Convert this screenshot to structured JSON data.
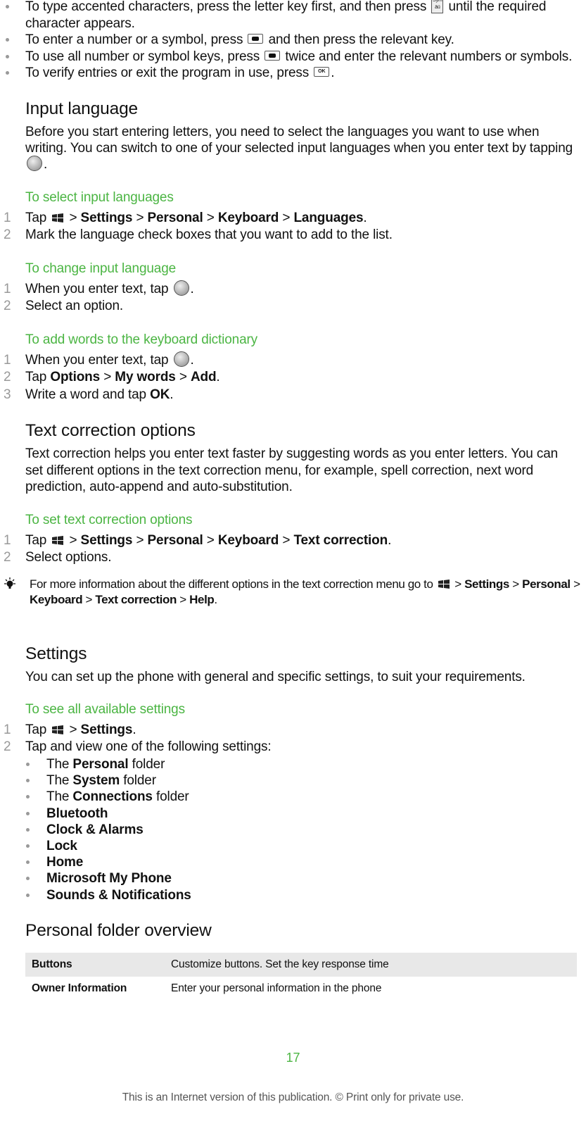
{
  "blocks": [
    {
      "type": "bul",
      "parts": [
        {
          "t": "To type accented characters, press the letter key first, and then press "
        },
        {
          "icon": "sym-key-icon"
        },
        {
          "t": " until the required character appears."
        }
      ]
    },
    {
      "type": "bul",
      "parts": [
        {
          "t": "To enter a number or a symbol, press "
        },
        {
          "icon": "dot-key-icon"
        },
        {
          "t": " and then press the relevant key."
        }
      ]
    },
    {
      "type": "bul",
      "parts": [
        {
          "t": "To use all number or symbol keys, press "
        },
        {
          "icon": "dot-key-icon"
        },
        {
          "t": " twice and enter the relevant numbers or symbols."
        }
      ]
    },
    {
      "type": "bul",
      "parts": [
        {
          "t": "To verify entries or exit the program in use, press "
        },
        {
          "icon": "ok-key-icon"
        },
        {
          "t": "."
        }
      ]
    },
    {
      "type": "h2",
      "parts": [
        {
          "t": "Input language"
        }
      ]
    },
    {
      "type": "para",
      "parts": [
        {
          "t": "Before you start entering letters, you need to select the languages you want to use when writing. You can switch to one of your selected input languages when you enter text by tapping "
        },
        {
          "icon": "globe-icon"
        },
        {
          "t": "."
        }
      ]
    },
    {
      "type": "green",
      "parts": [
        {
          "t": "To select input languages"
        }
      ]
    },
    {
      "type": "step",
      "n": "1",
      "parts": [
        {
          "t": "Tap "
        },
        {
          "icon": "windows-start-icon"
        },
        {
          "t": " > "
        },
        {
          "b": "Settings"
        },
        {
          "t": " > "
        },
        {
          "b": "Personal"
        },
        {
          "t": " > "
        },
        {
          "b": "Keyboard"
        },
        {
          "t": " > "
        },
        {
          "b": "Languages"
        },
        {
          "t": "."
        }
      ]
    },
    {
      "type": "step",
      "n": "2",
      "parts": [
        {
          "t": "Mark the language check boxes that you want to add to the list."
        }
      ]
    },
    {
      "type": "green",
      "parts": [
        {
          "t": "To change input language"
        }
      ]
    },
    {
      "type": "step",
      "n": "1",
      "parts": [
        {
          "t": "When you enter text, tap "
        },
        {
          "icon": "globe-icon"
        },
        {
          "t": "."
        }
      ]
    },
    {
      "type": "step",
      "n": "2",
      "parts": [
        {
          "t": "Select an option."
        }
      ]
    },
    {
      "type": "green",
      "parts": [
        {
          "t": "To add words to the keyboard dictionary"
        }
      ]
    },
    {
      "type": "step",
      "n": "1",
      "parts": [
        {
          "t": "When you enter text, tap "
        },
        {
          "icon": "globe-icon"
        },
        {
          "t": "."
        }
      ]
    },
    {
      "type": "step",
      "n": "2",
      "parts": [
        {
          "t": "Tap "
        },
        {
          "b": "Options"
        },
        {
          "t": " > "
        },
        {
          "b": "My words"
        },
        {
          "t": " > "
        },
        {
          "b": "Add"
        },
        {
          "t": "."
        }
      ]
    },
    {
      "type": "step",
      "n": "3",
      "parts": [
        {
          "t": "Write a word and tap "
        },
        {
          "b": "OK"
        },
        {
          "t": "."
        }
      ]
    },
    {
      "type": "h2",
      "parts": [
        {
          "t": "Text correction options"
        }
      ]
    },
    {
      "type": "para",
      "parts": [
        {
          "t": "Text correction helps you enter text faster by suggesting words as you enter letters. You can set different options in the text correction menu, for example, spell correction, next word prediction, auto-append and auto-substitution."
        }
      ]
    },
    {
      "type": "green",
      "parts": [
        {
          "t": "To set text correction options"
        }
      ]
    },
    {
      "type": "step",
      "n": "1",
      "parts": [
        {
          "t": "Tap "
        },
        {
          "icon": "windows-start-icon"
        },
        {
          "t": " > "
        },
        {
          "b": "Settings"
        },
        {
          "t": " > "
        },
        {
          "b": "Personal"
        },
        {
          "t": " > "
        },
        {
          "b": "Keyboard"
        },
        {
          "t": " > "
        },
        {
          "b": "Text correction"
        },
        {
          "t": "."
        }
      ]
    },
    {
      "type": "step",
      "n": "2",
      "parts": [
        {
          "t": "Select options."
        }
      ]
    },
    {
      "type": "note",
      "parts": [
        {
          "t": "For more information about the different options in the text correction menu go to "
        },
        {
          "icon": "windows-start-icon"
        },
        {
          "t": " > "
        },
        {
          "b": "Settings"
        },
        {
          "t": " > "
        },
        {
          "b": "Personal"
        },
        {
          "t": " > "
        },
        {
          "b": "Keyboard"
        },
        {
          "t": " > "
        },
        {
          "b": "Text correction"
        },
        {
          "t": " > "
        },
        {
          "b": "Help"
        },
        {
          "t": "."
        }
      ]
    },
    {
      "type": "h2 big",
      "parts": [
        {
          "t": "Settings"
        }
      ]
    },
    {
      "type": "para",
      "parts": [
        {
          "t": "You can set up the phone with general and specific settings, to suit your requirements."
        }
      ]
    },
    {
      "type": "green",
      "parts": [
        {
          "t": "To see all available settings"
        }
      ]
    },
    {
      "type": "step",
      "n": "1",
      "parts": [
        {
          "t": "Tap "
        },
        {
          "icon": "windows-start-icon"
        },
        {
          "t": " > "
        },
        {
          "b": "Settings"
        },
        {
          "t": "."
        }
      ]
    },
    {
      "type": "step",
      "n": "2",
      "parts": [
        {
          "t": "Tap and view one of the following settings:"
        }
      ]
    },
    {
      "type": "sbul",
      "parts": [
        {
          "t": "The "
        },
        {
          "b": "Personal"
        },
        {
          "t": " folder"
        }
      ]
    },
    {
      "type": "sbul",
      "parts": [
        {
          "t": "The "
        },
        {
          "b": "System"
        },
        {
          "t": " folder"
        }
      ]
    },
    {
      "type": "sbul",
      "parts": [
        {
          "t": "The "
        },
        {
          "b": "Connections"
        },
        {
          "t": " folder"
        }
      ]
    },
    {
      "type": "sbul",
      "parts": [
        {
          "b": "Bluetooth"
        }
      ]
    },
    {
      "type": "sbul",
      "parts": [
        {
          "b": "Clock & Alarms"
        }
      ]
    },
    {
      "type": "sbul",
      "parts": [
        {
          "b": "Lock"
        }
      ]
    },
    {
      "type": "sbul",
      "parts": [
        {
          "b": "Home"
        }
      ]
    },
    {
      "type": "sbul",
      "parts": [
        {
          "b": "Microsoft My Phone"
        }
      ]
    },
    {
      "type": "sbul",
      "parts": [
        {
          "b": "Sounds & Notifications"
        }
      ]
    },
    {
      "type": "h2",
      "parts": [
        {
          "t": "Personal folder overview"
        }
      ]
    }
  ],
  "table": [
    {
      "key": "Buttons",
      "value": "Customize buttons. Set the key response time"
    },
    {
      "key": "Owner Information",
      "value": "Enter your personal information in the phone"
    }
  ],
  "page_number": "17",
  "footer": "This is an Internet version of this publication. © Print only for private use.",
  "colors": {
    "heading_green": "#4bb543",
    "table_stripe": "#e8e8e8"
  }
}
